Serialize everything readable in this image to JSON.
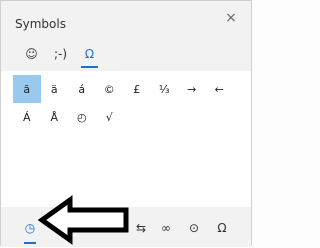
{
  "window": {
    "title": "Symbols",
    "close_label": "×"
  },
  "tabs": [
    {
      "label": "☺",
      "active": false
    },
    {
      "label": ";-)",
      "active": false
    },
    {
      "label": "Ω",
      "active": true
    }
  ],
  "symbols": [
    {
      "label": "ā",
      "selected": true
    },
    {
      "label": "ä",
      "selected": false
    },
    {
      "label": "á",
      "selected": false
    },
    {
      "label": "©",
      "selected": false
    },
    {
      "label": "£",
      "selected": false
    },
    {
      "label": "⅓",
      "selected": false
    },
    {
      "label": "→",
      "selected": false
    },
    {
      "label": "←",
      "selected": false
    },
    {
      "label": "Á",
      "selected": false
    },
    {
      "label": "Å",
      "selected": false
    },
    {
      "label": "◴",
      "selected": false
    },
    {
      "label": "√",
      "selected": false
    }
  ],
  "categories": [
    {
      "label": "◷",
      "icon": "recent-clock-icon",
      "active": true
    },
    {
      "label": "⇆",
      "icon": "arrows-category-icon",
      "active": false
    },
    {
      "label": "∞",
      "icon": "math-category-icon",
      "active": false
    },
    {
      "label": "⊙",
      "icon": "shapes-category-icon",
      "active": false
    },
    {
      "label": "Ω",
      "icon": "greek-category-icon",
      "active": false
    }
  ],
  "colors": {
    "accent": "#1a73c8",
    "selection": "#99c9ef"
  }
}
